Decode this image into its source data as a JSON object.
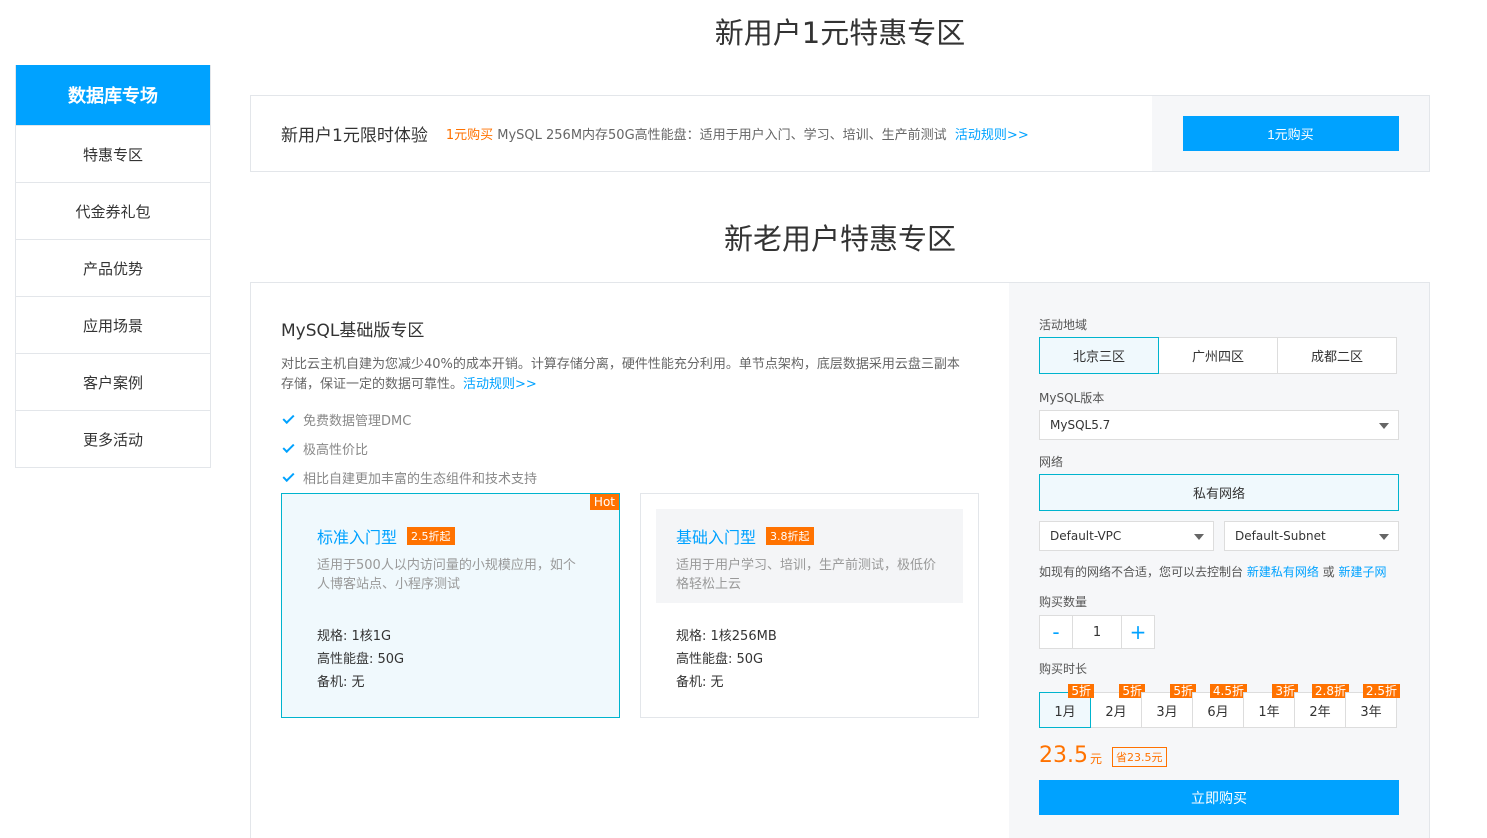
{
  "sidebar": {
    "title": "数据库专场",
    "items": [
      "特惠专区",
      "代金券礼包",
      "产品优势",
      "应用场景",
      "客户案例",
      "更多活动"
    ]
  },
  "section1": {
    "title": "新用户1元特惠专区",
    "promo_name": "新用户1元限时体验",
    "promo_highlight": "1元购买",
    "promo_desc": " MySQL 256M内存50G高性能盘：适用于用户入门、学习、培训、生产前测试",
    "rules_link": "活动规则>>",
    "buy_label": "1元购买"
  },
  "section2": {
    "title": "新老用户特惠专区",
    "panel_title": "MySQL基础版专区",
    "panel_desc": "对比云主机自建为您减少40%的成本开销。计算存储分离，硬件性能充分利用。单节点架构，底层数据采用云盘三副本存储，保证一定的数据可靠性。",
    "rules_link": "活动规则>>",
    "features": [
      "免费数据管理DMC",
      "极高性价比",
      "相比自建更加丰富的生态组件和技术支持"
    ],
    "cards": [
      {
        "name": "标准入门型",
        "discount": "2.5折起",
        "desc": "适用于500人以内访问量的小规模应用，如个人博客站点、小程序测试",
        "specs": [
          "规格: 1核1G",
          "高性能盘: 50G",
          "备机: 无"
        ],
        "badge": "Hot"
      },
      {
        "name": "基础入门型",
        "discount": "3.8折起",
        "desc": "适用于用户学习、培训，生产前测试，极低价格轻松上云",
        "specs": [
          "规格: 1核256MB",
          "高性能盘: 50G",
          "备机: 无"
        ]
      }
    ]
  },
  "order": {
    "region_label": "活动地域",
    "regions": [
      "北京三区",
      "广州四区",
      "成都二区"
    ],
    "version_label": "MySQL版本",
    "version_value": "MySQL5.7",
    "network_label": "网络",
    "network_value": "私有网络",
    "vpc_value": "Default-VPC",
    "subnet_value": "Default-Subnet",
    "hint_text": "如现有的网络不合适，您可以去控制台 ",
    "hint_link1": "新建私有网络",
    "hint_or": " 或 ",
    "hint_link2": "新建子网",
    "qty_label": "购买数量",
    "qty_minus": "-",
    "qty_value": "1",
    "qty_plus": "+",
    "duration_label": "购买时长",
    "durations": [
      {
        "label": "1月",
        "tag": "5折"
      },
      {
        "label": "2月",
        "tag": "5折"
      },
      {
        "label": "3月",
        "tag": "5折"
      },
      {
        "label": "6月",
        "tag": "4.5折"
      },
      {
        "label": "1年",
        "tag": "3折"
      },
      {
        "label": "2年",
        "tag": "2.8折"
      },
      {
        "label": "3年",
        "tag": "2.5折"
      }
    ],
    "price": "23.5",
    "price_unit": "元",
    "save_text": "省23.5元",
    "buy_label": "立即购买"
  },
  "colors": {
    "accent": "#00a2ff",
    "orange": "#ff7200",
    "active_border": "#00b4ce"
  }
}
